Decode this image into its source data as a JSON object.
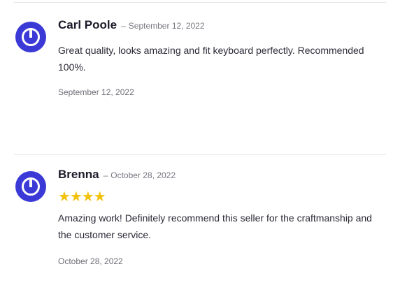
{
  "reviews": [
    {
      "author": "Carl Poole",
      "separator": "–",
      "date": "September 12, 2022",
      "text": "Great quality, looks amazing and fit keyboard perfectly. Recommended 100%.",
      "footer_date": "September 12, 2022"
    },
    {
      "author": "Brenna",
      "separator": "–",
      "date": "October 28, 2022",
      "rating_stars": "★★★★",
      "rating": 4,
      "text": "Amazing work! Definitely recommend this seller for the craftmanship and the customer service.",
      "footer_date": "October 28, 2022"
    }
  ],
  "colors": {
    "avatar": "#3b3ad7",
    "star": "#f2c20e",
    "divider": "#e6e6ea"
  }
}
